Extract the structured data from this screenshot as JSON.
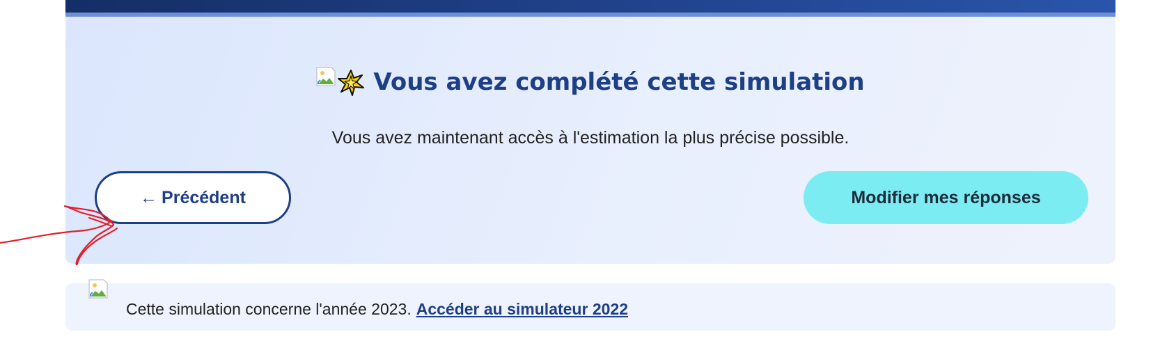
{
  "completion": {
    "title": "Vous avez complété cette simulation",
    "title_image_icon": "broken-image-icon",
    "title_star_icon": "sparkle-star-icon",
    "subtitle": "Vous avez maintenant accès à l'estimation la plus précise possible."
  },
  "buttons": {
    "previous_arrow": "←",
    "previous_label": "Précédent",
    "modify_label": "Modifier mes réponses"
  },
  "footer": {
    "image_icon": "broken-image-icon",
    "text": "Cette simulation concerne l'année 2023.",
    "link_label": "Accéder au simulateur 2022"
  },
  "colors": {
    "header_bar": "#1f3f86",
    "panel_background": "#e3ebfd",
    "title_color": "#1e3f86",
    "modify_button_background": "#7becf2",
    "footer_background": "#eef3fd",
    "annotation_stroke": "#e0202a"
  }
}
